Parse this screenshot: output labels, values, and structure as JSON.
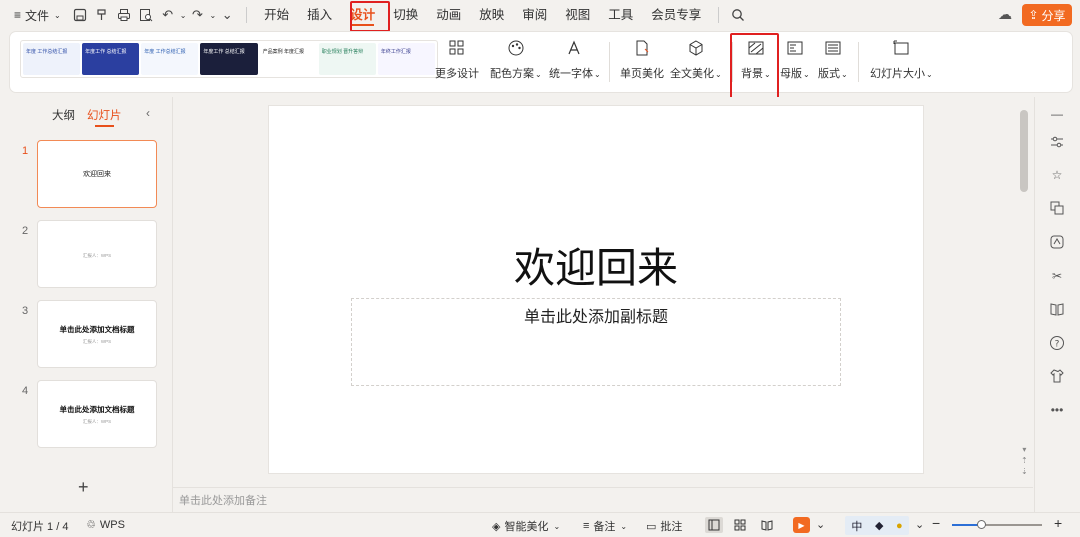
{
  "menubar": {
    "menu_icon": "≡",
    "file_label": "文件",
    "tabs": [
      "开始",
      "插入",
      "设计",
      "切换",
      "动画",
      "放映",
      "审阅",
      "视图",
      "工具",
      "会员专享"
    ],
    "active_tab": "设计",
    "share_label": "分享"
  },
  "ribbon": {
    "templates": [
      {
        "text": "年度 工作总结汇报",
        "bg": "#eef2fb",
        "fg": "#2f4ea8"
      },
      {
        "text": "年度工作 总结汇报",
        "bg": "#2b3fa0",
        "fg": "#ffffff"
      },
      {
        "text": "年度 工作总结汇报",
        "bg": "#f4f7fd",
        "fg": "#2a5db0"
      },
      {
        "text": "年度工作 总结汇报",
        "bg": "#1b1f3b",
        "fg": "#ffffff"
      },
      {
        "text": "产品案例 年度汇报",
        "bg": "#ffffff",
        "fg": "#222222"
      },
      {
        "text": "职业规划 晋升答辩",
        "bg": "#eef7f3",
        "fg": "#1e7a55"
      },
      {
        "text": "年终工作汇报",
        "bg": "#f7f6ff",
        "fg": "#3a3f8f"
      }
    ],
    "buttons": {
      "more_design": "更多设计",
      "color_scheme": "配色方案",
      "unify_font": "统一字体",
      "page_beautify": "单页美化",
      "full_beautify": "全文美化",
      "background": "背景",
      "master": "母版",
      "layout": "版式",
      "slide_size": "幻灯片大小"
    }
  },
  "left_panel": {
    "tab_outline": "大纲",
    "tab_slides": "幻灯片",
    "slides": [
      {
        "num": "1",
        "title": "欢迎回来",
        "sub": ""
      },
      {
        "num": "2",
        "title": "",
        "sub": "汇报人：WPS"
      },
      {
        "num": "3",
        "title": "单击此处添加文档标题",
        "sub": "汇报人：WPS"
      },
      {
        "num": "4",
        "title": "单击此处添加文档标题",
        "sub": "汇报人：WPS"
      }
    ],
    "add_icon": "+"
  },
  "slide": {
    "title": "欢迎回来",
    "subtitle_placeholder": "单击此处添加副标题"
  },
  "notes_placeholder": "单击此处添加备注",
  "statusbar": {
    "slide_count": "幻灯片 1 / 4",
    "theme_name": "WPS",
    "smart_beautify": "智能美化",
    "notes": "备注",
    "comments": "批注",
    "ime_lang": "中"
  },
  "colors": {
    "accent": "#e8501b",
    "share_bg": "#f26a21",
    "highlight_box": "#e02020"
  }
}
